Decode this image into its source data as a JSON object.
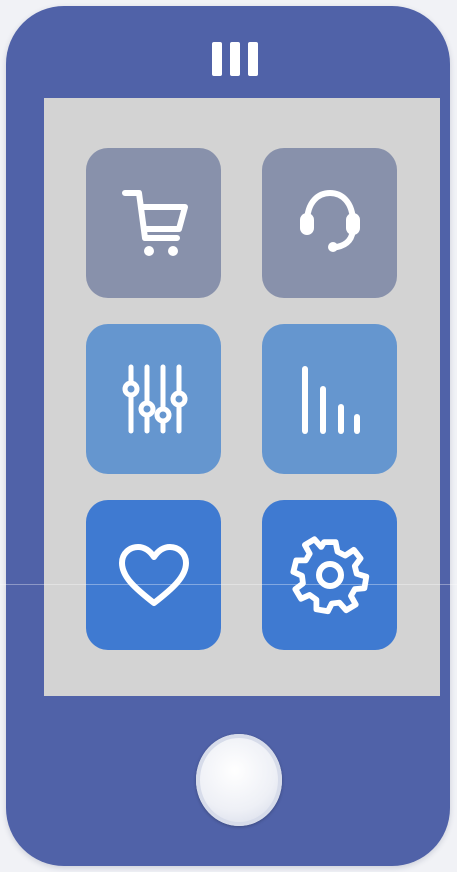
{
  "colors": {
    "background": "#f1f2f6",
    "phone_body": "#5062a8",
    "screen": "#d3d3d3",
    "icon_stroke": "#ffffff",
    "home_button": "#f2f4f9"
  },
  "speaker": {
    "icon": "speaker-grille-icon"
  },
  "tiles": [
    {
      "id": "cart",
      "icon": "shopping-cart-icon",
      "color": "#8891ab"
    },
    {
      "id": "support",
      "icon": "headset-icon",
      "color": "#8891ab"
    },
    {
      "id": "equalizer",
      "icon": "sliders-icon",
      "color": "#6596cf"
    },
    {
      "id": "stats",
      "icon": "bar-chart-icon",
      "color": "#6596cf"
    },
    {
      "id": "favorites",
      "icon": "heart-icon",
      "color": "#3f7ad1"
    },
    {
      "id": "settings",
      "icon": "gear-icon",
      "color": "#3f7ad1"
    }
  ],
  "home_button": {
    "icon": "home-button-icon"
  }
}
